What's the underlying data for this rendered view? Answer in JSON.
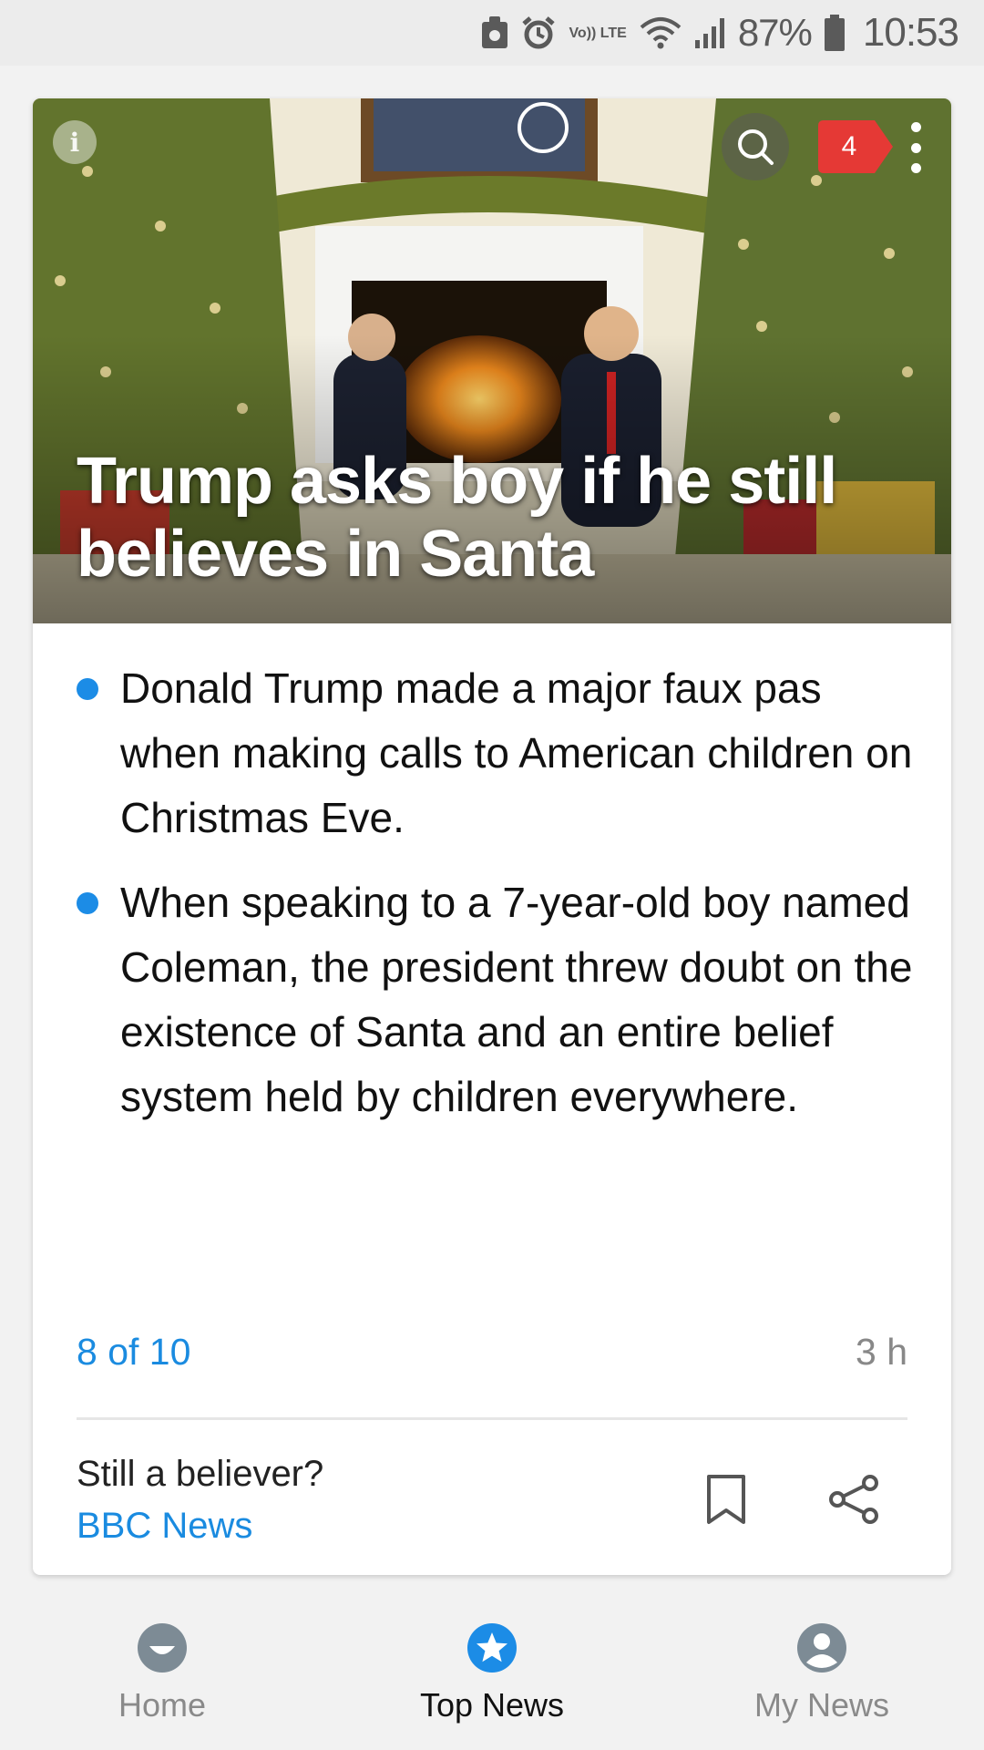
{
  "status_bar": {
    "network_label": "Vo)) LTE",
    "battery": "87%",
    "time": "10:53"
  },
  "article": {
    "title": "Trump asks boy if he still believes in Santa",
    "notification_count": "4",
    "bullets": [
      "Donald Trump made a major faux pas when making calls to American children on Christmas Eve.",
      "When speaking to a 7-year-old boy named Coleman, the president threw doubt on the existence of Santa and an entire belief system held by children everywhere."
    ],
    "position": "8 of 10",
    "age": "3 h",
    "headline": "Still a believer?",
    "source": "BBC News"
  },
  "nav": {
    "items": [
      {
        "label": "Home",
        "icon": "home-smile-icon"
      },
      {
        "label": "Top News",
        "icon": "star-icon"
      },
      {
        "label": "My News",
        "icon": "person-icon"
      }
    ],
    "active": "Top News"
  },
  "colors": {
    "accent": "#1a8be0",
    "badge": "#e53935",
    "nav_inactive": "#8a8a8a"
  }
}
